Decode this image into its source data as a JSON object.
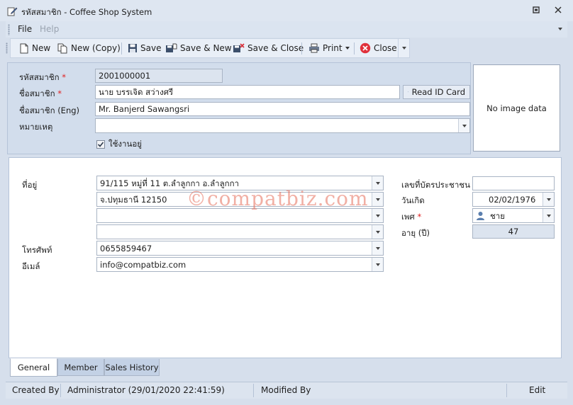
{
  "window": {
    "title": "รหัสสมาชิก - Coffee Shop System"
  },
  "menu": {
    "file": "File",
    "help": "Help"
  },
  "toolbar": {
    "new": "New",
    "new_copy": "New (Copy)",
    "save": "Save",
    "save_new": "Save & New",
    "save_close": "Save & Close",
    "print": "Print",
    "close": "Close"
  },
  "member": {
    "code_label": "รหัสสมาชิก",
    "code_value": "2001000001",
    "name_label": "ชื่อสมาชิก",
    "name_value": "นาย บรรเจิด สว่างศรี",
    "read_id_card": "Read ID Card",
    "name_eng_label": "ชื่อสมาชิก (Eng)",
    "name_eng_value": "Mr. Banjerd Sawangsri",
    "note_label": "หมายเหตุ",
    "note_value": "",
    "active_label": "ใช้งานอยู่",
    "active_checked": true,
    "required_mark": "*"
  },
  "image": {
    "placeholder": "No image data"
  },
  "general": {
    "address_label": "ที่อยู่",
    "address_lines": [
      "91/115 หมู่ที่ 11 ต.ลำลูกกา อ.ลำลูกกา",
      "จ.ปทุมธานี 12150",
      "",
      ""
    ],
    "phone_label": "โทรศัพท์",
    "phone_value": "0655859467",
    "email_label": "อีเมล์",
    "email_value": "info@compatbiz.com",
    "id_card_label": "เลขที่บัตรประชาชน",
    "id_card_value": "",
    "birthdate_label": "วันเกิด",
    "birthdate_value": "02/02/1976",
    "gender_label": "เพศ",
    "gender_value": "ชาย",
    "age_label": "อายุ (ปี)",
    "age_value": "47"
  },
  "watermark": "©compatbiz.com",
  "tabs": [
    {
      "label": "General",
      "active": true
    },
    {
      "label": "Member",
      "active": false
    },
    {
      "label": "Sales History",
      "active": false
    }
  ],
  "status": {
    "created_by_label": "Created By",
    "created_by_value": "Administrator (29/01/2020 22:41:59)",
    "modified_by_label": "Modified By",
    "mode": "Edit"
  },
  "colors": {
    "required": "#e02020",
    "close_icon": "#e0313b",
    "accent": "#2b5797"
  }
}
